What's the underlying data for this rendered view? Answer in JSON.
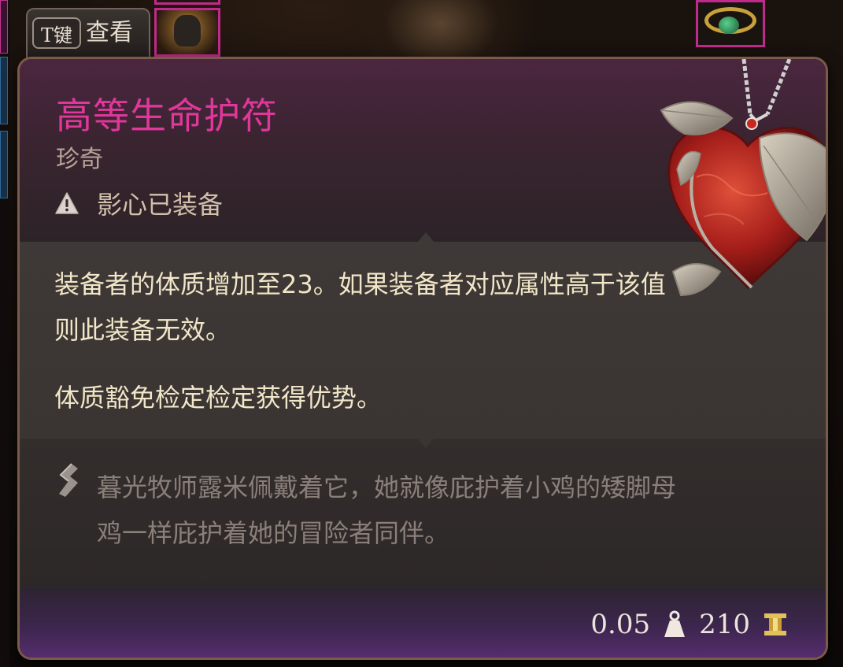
{
  "inspect_tab": {
    "key": "T键",
    "label": "查看"
  },
  "item": {
    "name": "高等生命护符",
    "rarity": "珍奇",
    "equipped_by": "影心已装备",
    "description": [
      "装备者的体质增加至23。如果装备者对应属性高于该值",
      "则此装备无效。",
      "体质豁免检定检定获得优势。"
    ],
    "lore": [
      "暮光牧师露米佩戴着它，她就像庇护着小鸡的矮脚母",
      "鸡一样庇护着她的冒险者同伴。"
    ],
    "weight": "0.05",
    "value": "210"
  },
  "colors": {
    "title": "#e0379a",
    "rarity": "#b8a59a",
    "description_text": "#f1e6c8",
    "lore_text": "#8a7f79",
    "slot_border": "#c02a8c"
  },
  "icons": {
    "warning": "warning-triangle-icon",
    "lore": "lore-quill-icon",
    "weight": "weight-icon",
    "gold": "gold-coin-icon",
    "item": "heart-amulet-icon"
  }
}
